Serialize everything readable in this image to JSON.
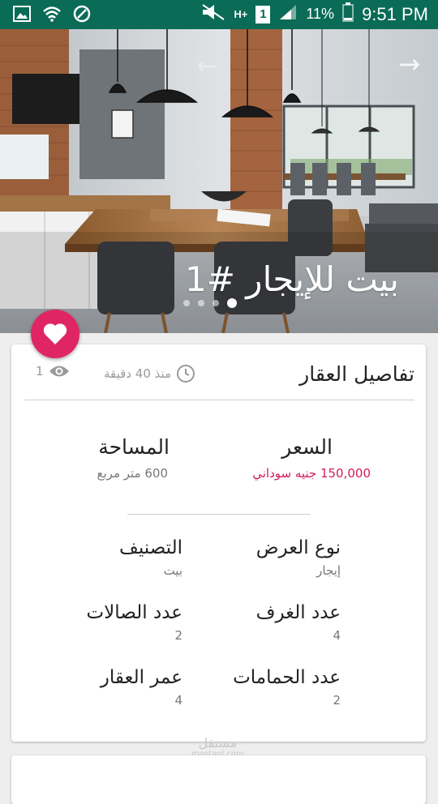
{
  "status_bar": {
    "battery_percent": "11%",
    "time": "9:51 PM",
    "network_label": "H+",
    "sim_slot": "1"
  },
  "hero": {
    "title": "بيت للإيجار #1",
    "dots_count": 4,
    "active_dot": 3
  },
  "details": {
    "title": "تفاصيل العقار",
    "posted_time": "منذ 40 دقيقة",
    "views_count": "1",
    "price_label": "السعر",
    "price_value": "150,000 جنيه سوداني",
    "area_label": "المساحة",
    "area_value": "600 متر مربع",
    "offer_type_label": "نوع العرض",
    "offer_type_value": "إيجار",
    "category_label": "التصنيف",
    "category_value": "بيت",
    "rooms_label": "عدد الغرف",
    "rooms_value": "4",
    "halls_label": "عدد الصالات",
    "halls_value": "2",
    "bathrooms_label": "عدد الحمامات",
    "bathrooms_value": "2",
    "age_label": "عمر العقار",
    "age_value": "4"
  },
  "watermark": {
    "text": "مستقل",
    "sub": "mostaql.com"
  },
  "colors": {
    "status_bar": "#0a6b56",
    "accent": "#e02565",
    "price": "#d41b5a"
  }
}
